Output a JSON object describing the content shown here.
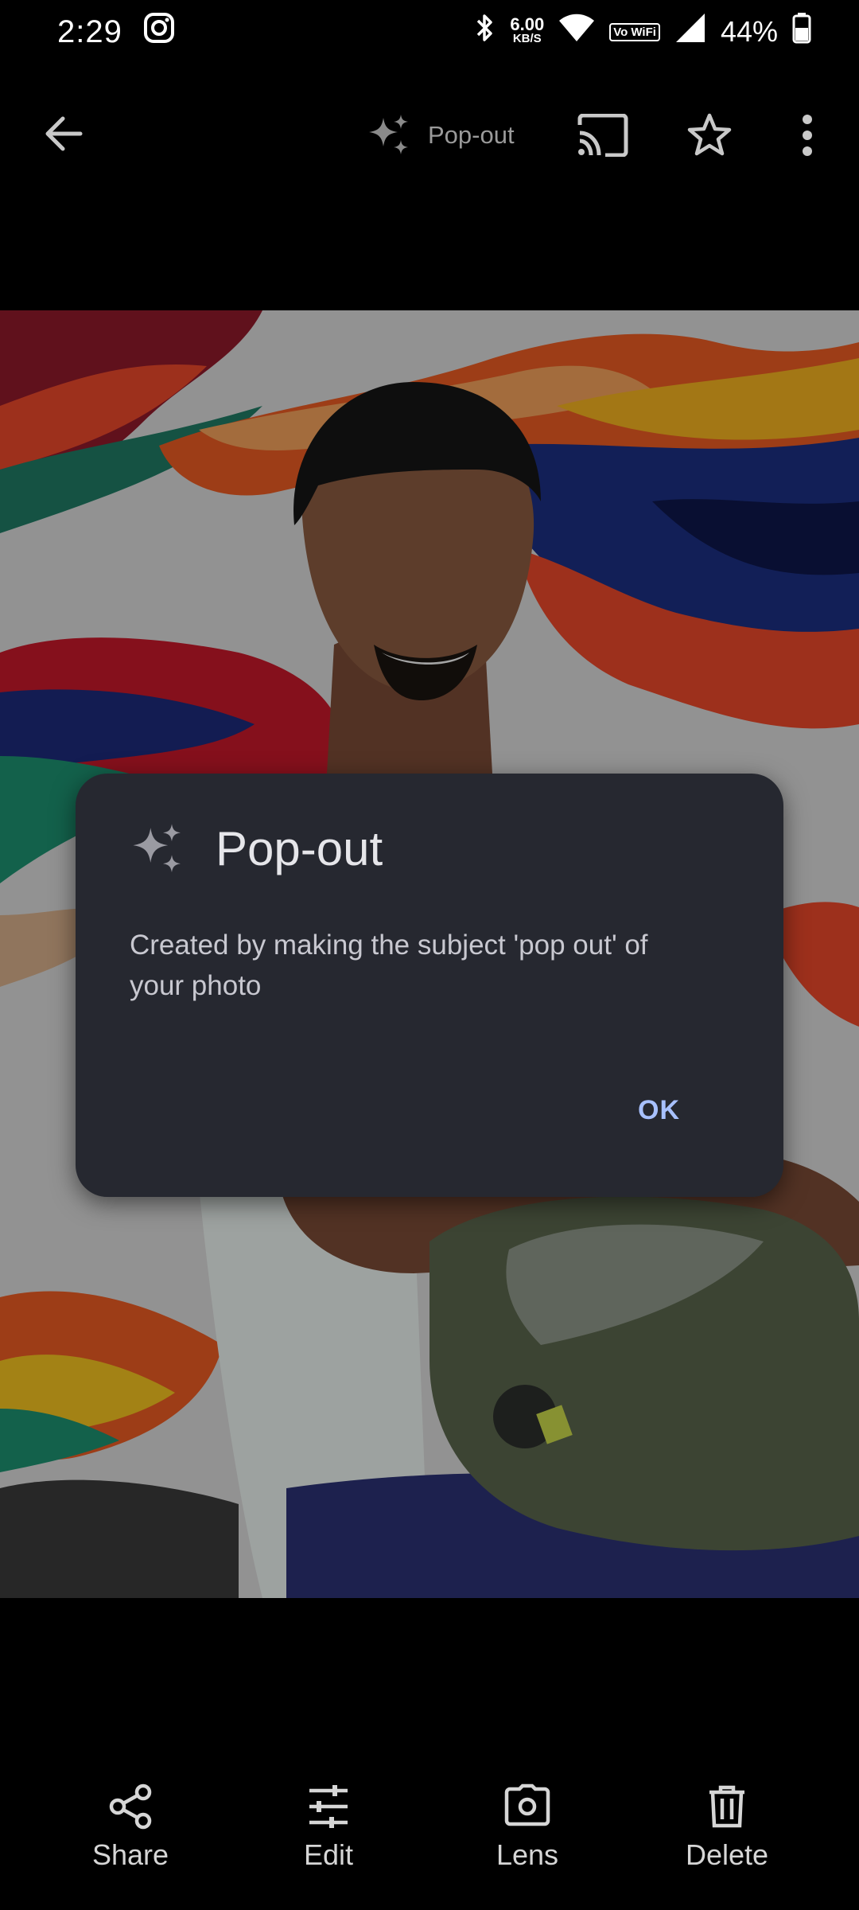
{
  "status_bar": {
    "time": "2:29",
    "net_speed_value": "6.00",
    "net_speed_unit": "KB/S",
    "volte_label": "Vo WiFi",
    "battery": "44%",
    "icons": [
      "instagram-icon",
      "bluetooth-icon",
      "wifi-icon",
      "vowifi-icon",
      "signal-icon",
      "battery-icon"
    ]
  },
  "top_bar": {
    "popout_label": "Pop-out",
    "icons": [
      "back-arrow-icon",
      "sparkle-icon",
      "cast-icon",
      "star-icon",
      "more-vert-icon"
    ]
  },
  "dialog": {
    "title": "Pop-out",
    "body": "Created by making the subject 'pop out' of your photo",
    "ok_label": "OK"
  },
  "bottom_bar": {
    "items": [
      {
        "label": "Share",
        "icon": "share-icon"
      },
      {
        "label": "Edit",
        "icon": "tune-icon"
      },
      {
        "label": "Lens",
        "icon": "lens-icon"
      },
      {
        "label": "Delete",
        "icon": "trash-icon"
      }
    ]
  },
  "colors": {
    "background": "#000000",
    "dialog_bg": "#262830",
    "accent": "#a8c1ff",
    "muted_text": "#9a9a9a"
  }
}
